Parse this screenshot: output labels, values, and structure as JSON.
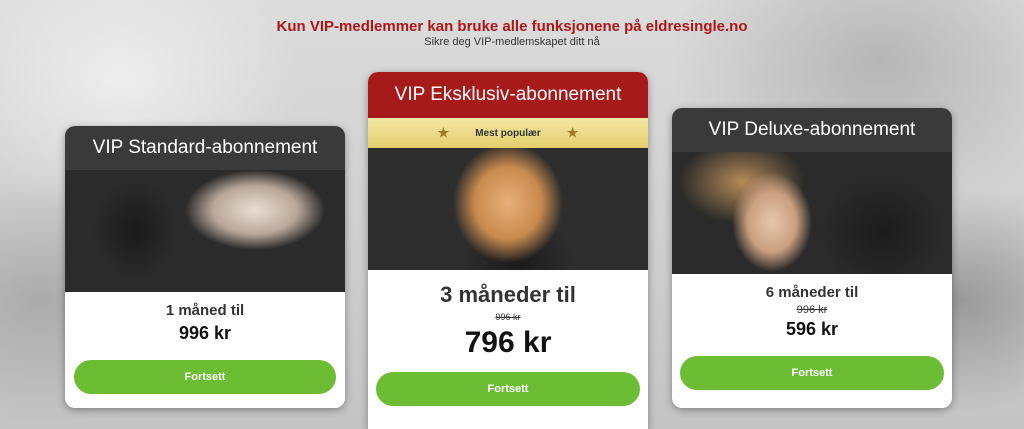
{
  "header": {
    "headline": "Kun VIP-medlemmer kan bruke alle funksjonene på eldresingle.no",
    "subline": "Sikre deg VIP-medlemskapet ditt nå"
  },
  "plans": [
    {
      "title": "VIP Standard-abonnement",
      "duration": "1 måned til",
      "price": "996 kr",
      "button": "Fortsett"
    },
    {
      "title": "VIP Eksklusiv-abonnement",
      "badge": "Mest populær",
      "badge_icon": "star-icon",
      "duration": "3 måneder til",
      "old_price": "996 kr",
      "price": "796 kr",
      "button": "Fortsett"
    },
    {
      "title": "VIP Deluxe-abonnement",
      "duration": "6 måneder til",
      "old_price": "996 kr",
      "price": "596 kr",
      "button": "Fortsett"
    }
  ],
  "colors": {
    "headline": "#b01515",
    "title_dark": "#3a3a3a",
    "title_featured": "#a61a1a",
    "ribbon": "#e4cf6e",
    "button": "#6cbd34"
  }
}
